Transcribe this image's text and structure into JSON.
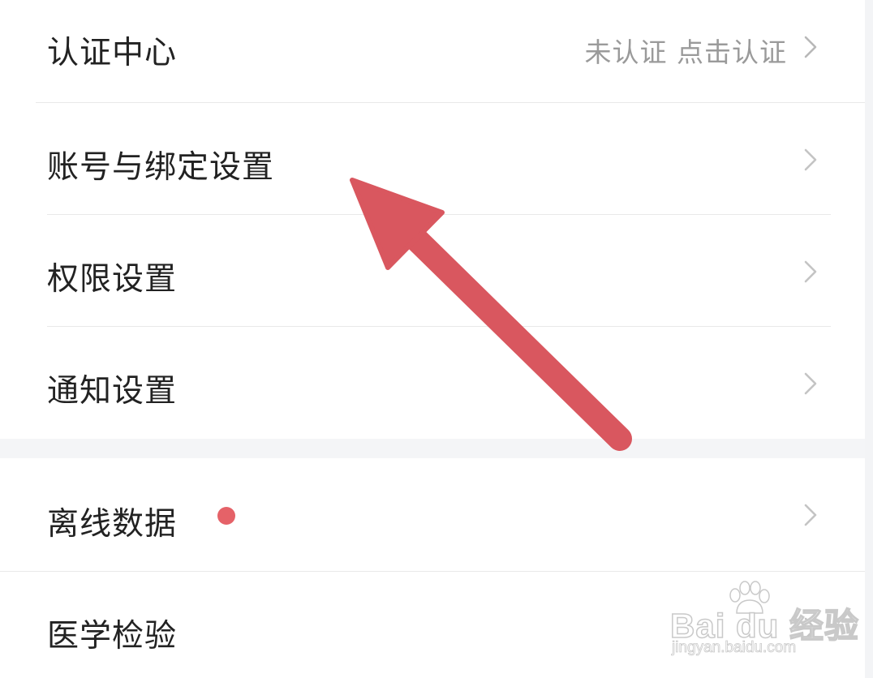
{
  "settings": {
    "items": [
      {
        "label": "认证中心",
        "value": "未认证 点击认证"
      },
      {
        "label": "账号与绑定设置"
      },
      {
        "label": "权限设置"
      },
      {
        "label": "通知设置"
      },
      {
        "label": "离线数据",
        "badge_color": "#e56268"
      },
      {
        "label": "医学检验"
      }
    ]
  },
  "annotation": {
    "arrow_color": "#d9575f"
  },
  "watermark": {
    "brand": "Bai du 经验",
    "url": "jingyan.baidu.com"
  }
}
